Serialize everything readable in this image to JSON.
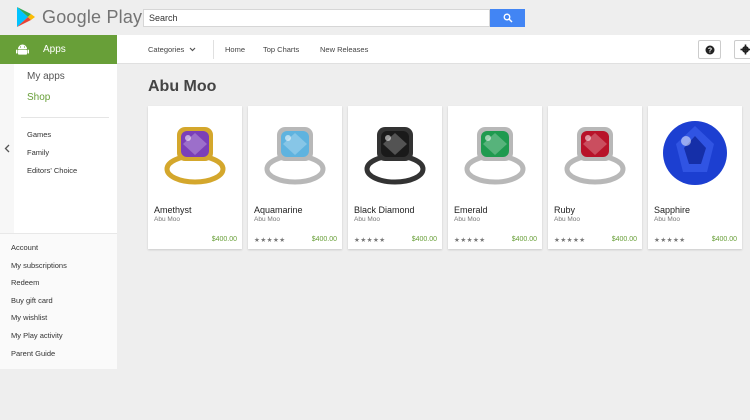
{
  "header": {
    "logo_text": "Google Play",
    "search_value": "Search"
  },
  "nav": {
    "apps_label": "Apps",
    "categories": "Categories",
    "home": "Home",
    "top_charts": "Top Charts",
    "new_releases": "New Releases"
  },
  "sidebar": {
    "my_apps": "My apps",
    "shop": "Shop",
    "categories": [
      "Games",
      "Family",
      "Editors' Choice"
    ],
    "account_links": [
      "Account",
      "My subscriptions",
      "Redeem",
      "Buy gift card",
      "My wishlist",
      "My Play activity",
      "Parent Guide"
    ]
  },
  "main": {
    "title": "Abu Moo",
    "cards": [
      {
        "title": "Amethyst",
        "developer": "Abu Moo",
        "price": "$400.00",
        "stars": "",
        "gem_color": "#7b3fb8",
        "metal": "gold"
      },
      {
        "title": "Aquamarine",
        "developer": "Abu Moo",
        "price": "$400.00",
        "stars": "★★★★★",
        "gem_color": "#5fb3df",
        "metal": "silver"
      },
      {
        "title": "Black Diamond",
        "developer": "Abu Moo",
        "price": "$400.00",
        "stars": "★★★★★",
        "gem_color": "#1a1a1a",
        "metal": "dark"
      },
      {
        "title": "Emerald",
        "developer": "Abu Moo",
        "price": "$400.00",
        "stars": "★★★★★",
        "gem_color": "#1f9a4f",
        "metal": "silver"
      },
      {
        "title": "Ruby",
        "developer": "Abu Moo",
        "price": "$400.00",
        "stars": "★★★★★",
        "gem_color": "#b8132a",
        "metal": "silver"
      },
      {
        "title": "Sapphire",
        "developer": "Abu Moo",
        "price": "$400.00",
        "stars": "★★★★★",
        "gem_color": "#1c3fd1",
        "metal": "none"
      }
    ]
  },
  "colors": {
    "brand_green": "#689f38",
    "search_blue": "#4285f4"
  }
}
